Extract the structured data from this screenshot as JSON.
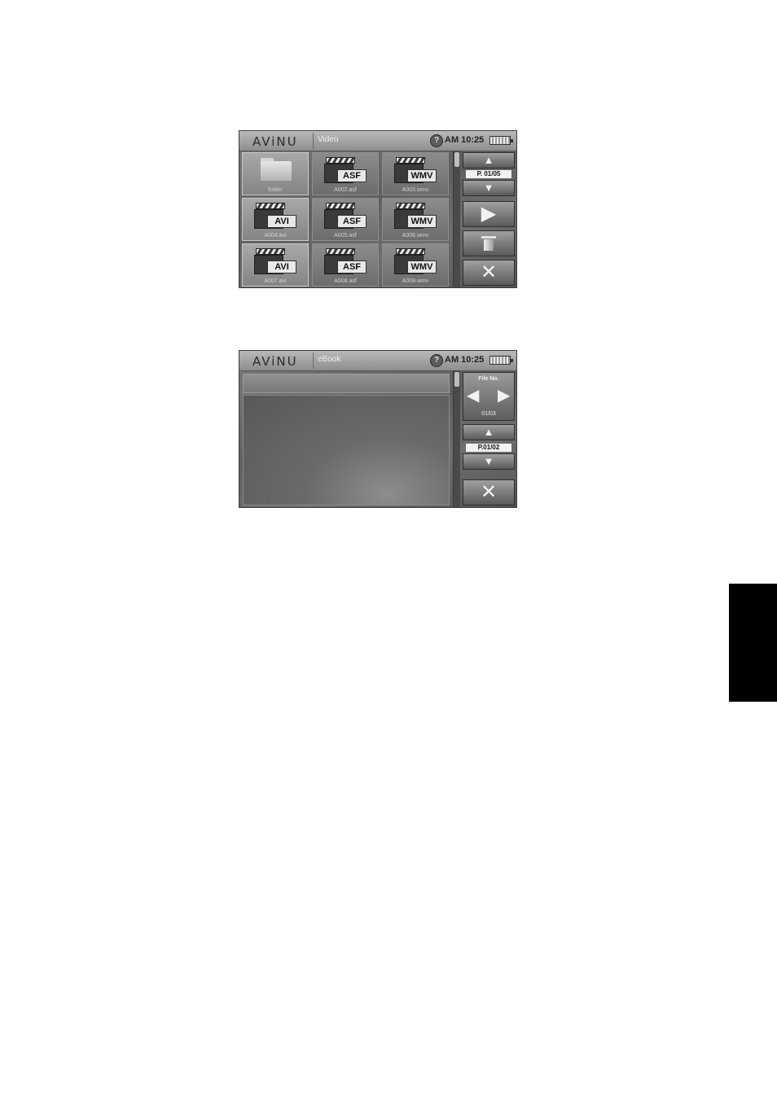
{
  "video": {
    "logo": "AViNU",
    "title": "Video",
    "help_icon": "?",
    "clock": "AM 10:25",
    "files": [
      {
        "name": "folder",
        "type": "folder",
        "ext": ""
      },
      {
        "name": "A002.asf",
        "type": "video",
        "ext": "ASF"
      },
      {
        "name": "A003.wmv",
        "type": "video",
        "ext": "WMV"
      },
      {
        "name": "A004.avi",
        "type": "video",
        "ext": "AVI"
      },
      {
        "name": "A005.asf",
        "type": "video",
        "ext": "ASF"
      },
      {
        "name": "A006.wmv",
        "type": "video",
        "ext": "WMV"
      },
      {
        "name": "A007.avi",
        "type": "video",
        "ext": "AVI"
      },
      {
        "name": "A008.asf",
        "type": "video",
        "ext": "ASF"
      },
      {
        "name": "A009.wmv",
        "type": "video",
        "ext": "WMV"
      }
    ],
    "page_up": "▲",
    "page": "P. 01/05",
    "page_down": "▼",
    "play": "▶",
    "close": "✕"
  },
  "ebook": {
    "logo": "AViNU",
    "title": "eBook",
    "help_icon": "?",
    "clock": "AM 10:25",
    "file_no_label": "File No.",
    "file_prev": "◀",
    "file_next": "▶",
    "file_no": "01/03",
    "page_up": "▲",
    "page": "P.01/02",
    "page_down": "▼",
    "close": "✕"
  }
}
